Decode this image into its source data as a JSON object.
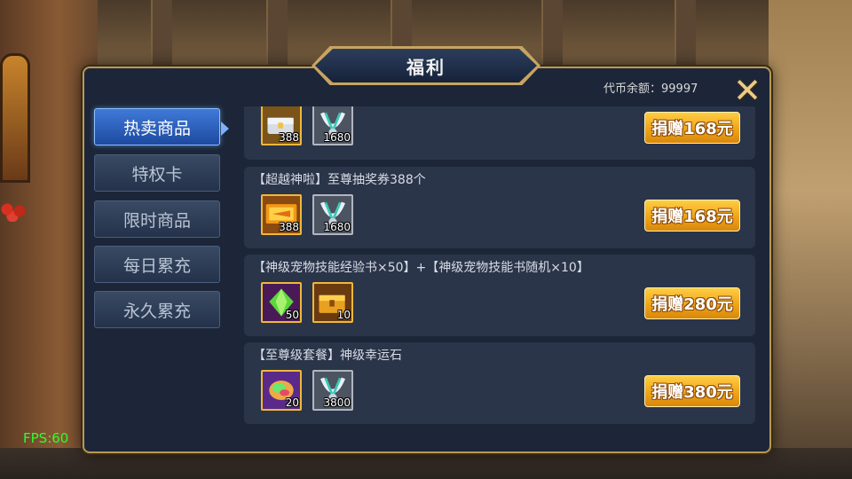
{
  "window": {
    "title": "福利"
  },
  "balance": {
    "text": "代币余额：99997"
  },
  "close": {
    "icon": "close-x-icon"
  },
  "sidebar": {
    "items": [
      {
        "label": "热卖商品",
        "active": true
      },
      {
        "label": "特权卡",
        "active": false
      },
      {
        "label": "限时商品",
        "active": false
      },
      {
        "label": "每日累充",
        "active": false
      },
      {
        "label": "永久累充",
        "active": false
      }
    ]
  },
  "cards": [
    {
      "title": "",
      "items": [
        {
          "icon": "treasure-chest-icon",
          "count": "388",
          "frame": "gold"
        },
        {
          "icon": "silver-necklace-icon",
          "count": "1680",
          "frame": "grey"
        }
      ],
      "button": "捐赠168元"
    },
    {
      "title": "【超越神啦】至尊抽奖券388个",
      "items": [
        {
          "icon": "lottery-ticket-icon",
          "count": "388",
          "frame": "gold"
        },
        {
          "icon": "silver-necklace-icon",
          "count": "1680",
          "frame": "grey"
        }
      ],
      "button": "捐赠168元"
    },
    {
      "title": "【神级宠物技能经验书×50】+【神级宠物技能书随机×10】",
      "items": [
        {
          "icon": "green-crystal-icon",
          "count": "50",
          "frame": "gold"
        },
        {
          "icon": "golden-chest-icon",
          "count": "10",
          "frame": "gold"
        }
      ],
      "button": "捐赠280元"
    },
    {
      "title": "【至尊级套餐】神级幸运石",
      "items": [
        {
          "icon": "rainbow-gem-icon",
          "count": "20",
          "frame": "gold"
        },
        {
          "icon": "silver-necklace-icon",
          "count": "3800",
          "frame": "grey"
        }
      ],
      "button": "捐赠380元"
    }
  ],
  "fps": "FPS:60",
  "colors": {
    "accent_gold": "#f0a418",
    "active_tab": "#3f7ad8",
    "panel": "#1c2638",
    "card": "#2a354a",
    "fps_green": "#2cff2c"
  }
}
